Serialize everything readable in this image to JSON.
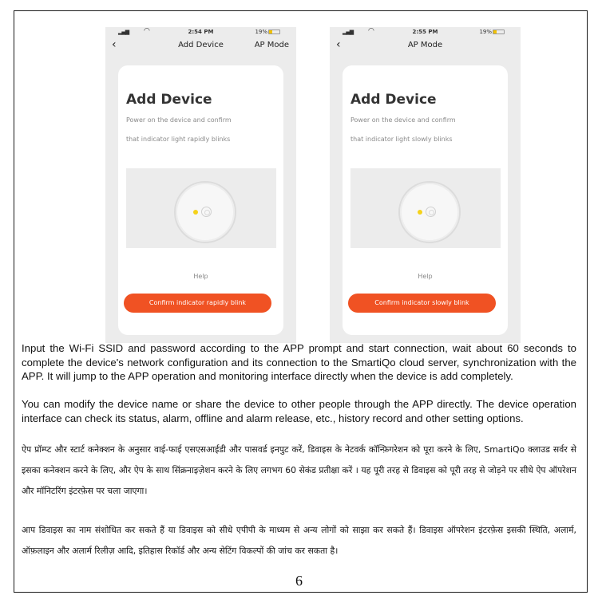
{
  "screens": [
    {
      "status": {
        "time": "2:54 PM",
        "battery": "19%"
      },
      "nav": {
        "back": "‹",
        "title": "Add Device",
        "action": "AP Mode"
      },
      "card": {
        "title": "Add Device",
        "desc_line1": "Power on the device and confirm",
        "desc_line2": "that indicator light rapidly blinks",
        "help": "Help",
        "button": "Confirm indicator rapidly blink"
      }
    },
    {
      "status": {
        "time": "2:55 PM",
        "battery": "19%"
      },
      "nav": {
        "back": "‹",
        "title": "AP Mode",
        "action": ""
      },
      "card": {
        "title": "Add Device",
        "desc_line1": "Power on the device and confirm",
        "desc_line2": "that indicator light slowly blinks",
        "help": "Help",
        "button": "Confirm indicator slowly blink"
      }
    }
  ],
  "body": {
    "para1": "Input the Wi-Fi SSID and password according to the APP prompt and start connection, wait about 60 seconds to complete the device's network configuration and its connection to the SmartiQo cloud server, synchronization with the APP. It will jump to the APP operation and monitoring interface directly when the device is add completely.",
    "para2": "You can modify the device name or share the device to other people through the APP directly. The device operation interface can check its status, alarm, offline and alarm release, etc., history record and other setting options.",
    "para3": "ऐप प्रॉम्प्ट और स्टार्ट कनेक्शन के अनुसार वाई-फाई एसएसआईडी और पासवर्ड इनपुट करें, डिवाइस के नेटवर्क कॉन्फ़िगरेशन को पूरा करने के लिए, SmartiQo क्लाउड सर्वर से इसका कनेक्शन करने के लिए, और ऐप के साथ सिंक्रनाइज़ेशन करने के लिए लगभग 60 सेकंड प्रतीक्षा करें । यह पूरी तरह से डिवाइस को पूरी तरह से जोड़ने पर सीधे ऐप ऑपरेशन और मॉनिटरिंग इंटरफ़ेस पर चला जाएगा।",
    "para4": "आप डिवाइस का नाम संशोधित कर सकते हैं या डिवाइस को सीधे एपीपी के माध्यम से अन्य लोगों को साझा कर सकते हैं। डिवाइस ऑपरेशन इंटरफ़ेस इसकी स्थिति, अलार्म, ऑफ़लाइन और अलार्म रिलीज़ आदि, इतिहास रिकॉर्ड और अन्य सेटिंग विकल्पों की जांच कर सकता है।"
  },
  "page_number": "6",
  "colors": {
    "accent": "#f05223",
    "led": "#f5d21b",
    "screen_bg": "#ececec"
  }
}
